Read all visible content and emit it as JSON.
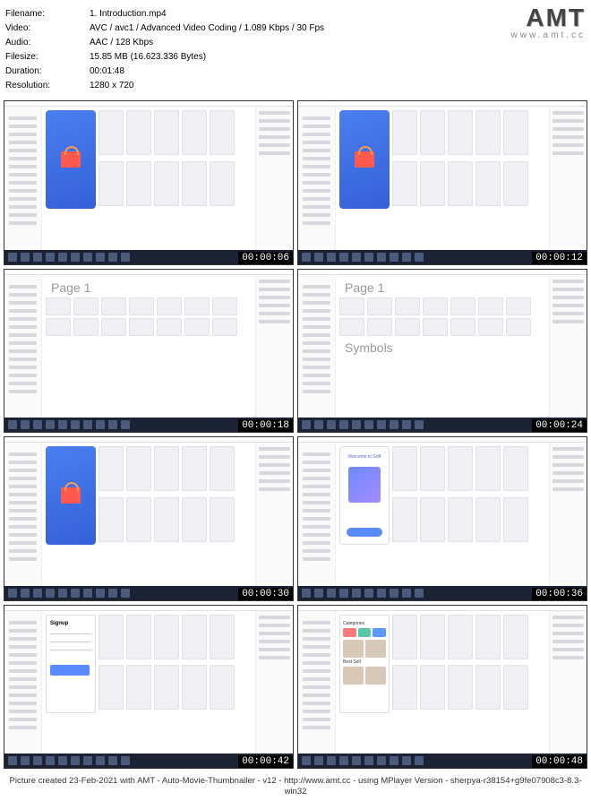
{
  "meta": {
    "filename_label": "Filename:",
    "filename": "1. Introduction.mp4",
    "video_label": "Video:",
    "video": "AVC / avc1 / Advanced Video Coding / 1.089 Kbps / 30 Fps",
    "audio_label": "Audio:",
    "audio": "AAC / 128 Kbps",
    "filesize_label": "Filesize:",
    "filesize": "15.85 MB (16.623.336 Bytes)",
    "duration_label": "Duration:",
    "duration": "00:01:48",
    "resolution_label": "Resolution:",
    "resolution": "1280 x 720"
  },
  "logo": {
    "text": "AMT",
    "url": "www.amt.cc"
  },
  "thumbs": [
    {
      "time": "00:00:06",
      "variant": "designer-cart"
    },
    {
      "time": "00:00:12",
      "variant": "designer-cart"
    },
    {
      "time": "00:00:18",
      "variant": "page1",
      "page_label": "Page 1"
    },
    {
      "time": "00:00:24",
      "variant": "page1-symbols",
      "page_label": "Page 1",
      "symbols_label": "Symbols"
    },
    {
      "time": "00:00:30",
      "variant": "designer-cart"
    },
    {
      "time": "00:00:36",
      "variant": "welcome",
      "welcome_text": "Welcome to Soft"
    },
    {
      "time": "00:00:42",
      "variant": "signup",
      "signup_label": "Signup"
    },
    {
      "time": "00:00:48",
      "variant": "categories",
      "cats_label": "Categories",
      "best_label": "Best Sell"
    }
  ],
  "footer": "Picture created 23-Feb-2021 with AMT - Auto-Movie-Thumbnailer - v12 - http://www.amt.cc - using MPlayer Version - sherpya-r38154+g9fe07908c3-8.3-win32"
}
